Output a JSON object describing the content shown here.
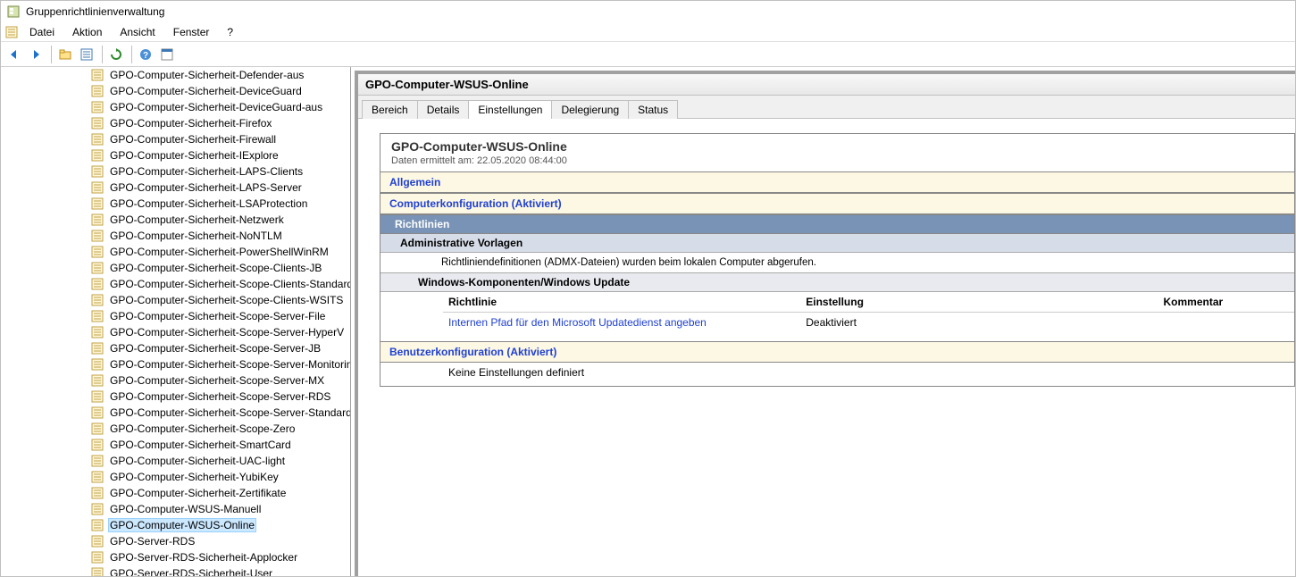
{
  "window": {
    "title": "Gruppenrichtlinienverwaltung"
  },
  "menu": {
    "file": "Datei",
    "action": "Aktion",
    "view": "Ansicht",
    "window_m": "Fenster",
    "help": "?"
  },
  "tree": {
    "items": [
      "GPO-Computer-Sicherheit-Defender-aus",
      "GPO-Computer-Sicherheit-DeviceGuard",
      "GPO-Computer-Sicherheit-DeviceGuard-aus",
      "GPO-Computer-Sicherheit-Firefox",
      "GPO-Computer-Sicherheit-Firewall",
      "GPO-Computer-Sicherheit-IExplore",
      "GPO-Computer-Sicherheit-LAPS-Clients",
      "GPO-Computer-Sicherheit-LAPS-Server",
      "GPO-Computer-Sicherheit-LSAProtection",
      "GPO-Computer-Sicherheit-Netzwerk",
      "GPO-Computer-Sicherheit-NoNTLM",
      "GPO-Computer-Sicherheit-PowerShellWinRM",
      "GPO-Computer-Sicherheit-Scope-Clients-JB",
      "GPO-Computer-Sicherheit-Scope-Clients-Standard",
      "GPO-Computer-Sicherheit-Scope-Clients-WSITS",
      "GPO-Computer-Sicherheit-Scope-Server-File",
      "GPO-Computer-Sicherheit-Scope-Server-HyperV",
      "GPO-Computer-Sicherheit-Scope-Server-JB",
      "GPO-Computer-Sicherheit-Scope-Server-Monitoring",
      "GPO-Computer-Sicherheit-Scope-Server-MX",
      "GPO-Computer-Sicherheit-Scope-Server-RDS",
      "GPO-Computer-Sicherheit-Scope-Server-Standard",
      "GPO-Computer-Sicherheit-Scope-Zero",
      "GPO-Computer-Sicherheit-SmartCard",
      "GPO-Computer-Sicherheit-UAC-light",
      "GPO-Computer-Sicherheit-YubiKey",
      "GPO-Computer-Sicherheit-Zertifikate",
      "GPO-Computer-WSUS-Manuell",
      "GPO-Computer-WSUS-Online",
      "GPO-Server-RDS",
      "GPO-Server-RDS-Sicherheit-Applocker",
      "GPO-Server-RDS-Sicherheit-User"
    ],
    "selected_index": 28
  },
  "detail": {
    "header": "GPO-Computer-WSUS-Online",
    "tabs": {
      "bereich": "Bereich",
      "details": "Details",
      "einstellungen": "Einstellungen",
      "delegierung": "Delegierung",
      "status": "Status"
    },
    "active_tab": "einstellungen",
    "report": {
      "title": "GPO-Computer-WSUS-Online",
      "date_label": "Daten ermittelt am: 22.05.2020 08:44:00",
      "allgemein": "Allgemein",
      "comp_config": "Computerkonfiguration (Aktiviert)",
      "richtlinien": "Richtlinien",
      "admin_vorlagen": "Administrative Vorlagen",
      "admx_note": "Richtliniendefinitionen (ADMX-Dateien) wurden beim lokalen Computer abgerufen.",
      "win_update_path": "Windows-Komponenten/Windows Update",
      "table": {
        "h_policy": "Richtlinie",
        "h_setting": "Einstellung",
        "h_comment": "Kommentar",
        "rows": [
          {
            "policy": "Internen Pfad für den Microsoft Updatedienst angeben",
            "setting": "Deaktiviert",
            "comment": ""
          }
        ]
      },
      "user_config": "Benutzerkonfiguration (Aktiviert)",
      "no_settings": "Keine Einstellungen definiert"
    }
  }
}
